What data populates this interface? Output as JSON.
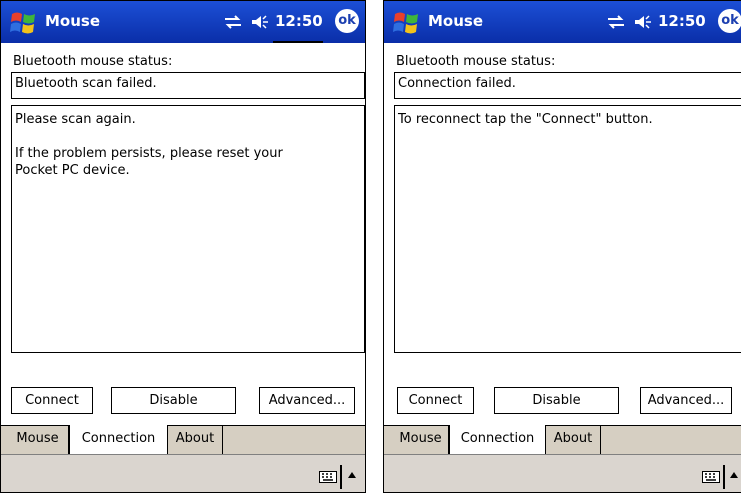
{
  "screens": [
    {
      "title": "Mouse",
      "clock": "12:50",
      "ok_label": "ok",
      "status_label": "Bluetooth mouse status:",
      "status_value": "Bluetooth scan failed.",
      "message": "Please scan again.\n\nIf the problem persists, please reset your\nPocket PC device.",
      "buttons": {
        "connect": "Connect",
        "disable": "Disable",
        "advanced": "Advanced..."
      },
      "tabs": [
        "Mouse",
        "Connection",
        "About"
      ],
      "active_tab": "Connection"
    },
    {
      "title": "Mouse",
      "clock": "12:50",
      "ok_label": "ok",
      "status_label": "Bluetooth mouse status:",
      "status_value": "Connection failed.",
      "message": "To reconnect tap the \"Connect\" button.",
      "buttons": {
        "connect": "Connect",
        "disable": "Disable",
        "advanced": "Advanced..."
      },
      "tabs": [
        "Mouse",
        "Connection",
        "About"
      ],
      "active_tab": "Connection"
    }
  ],
  "colors": {
    "titlebar": "#1c4fd6",
    "tabbar": "#d6cfc2",
    "cmdbar": "#dad5cf"
  }
}
